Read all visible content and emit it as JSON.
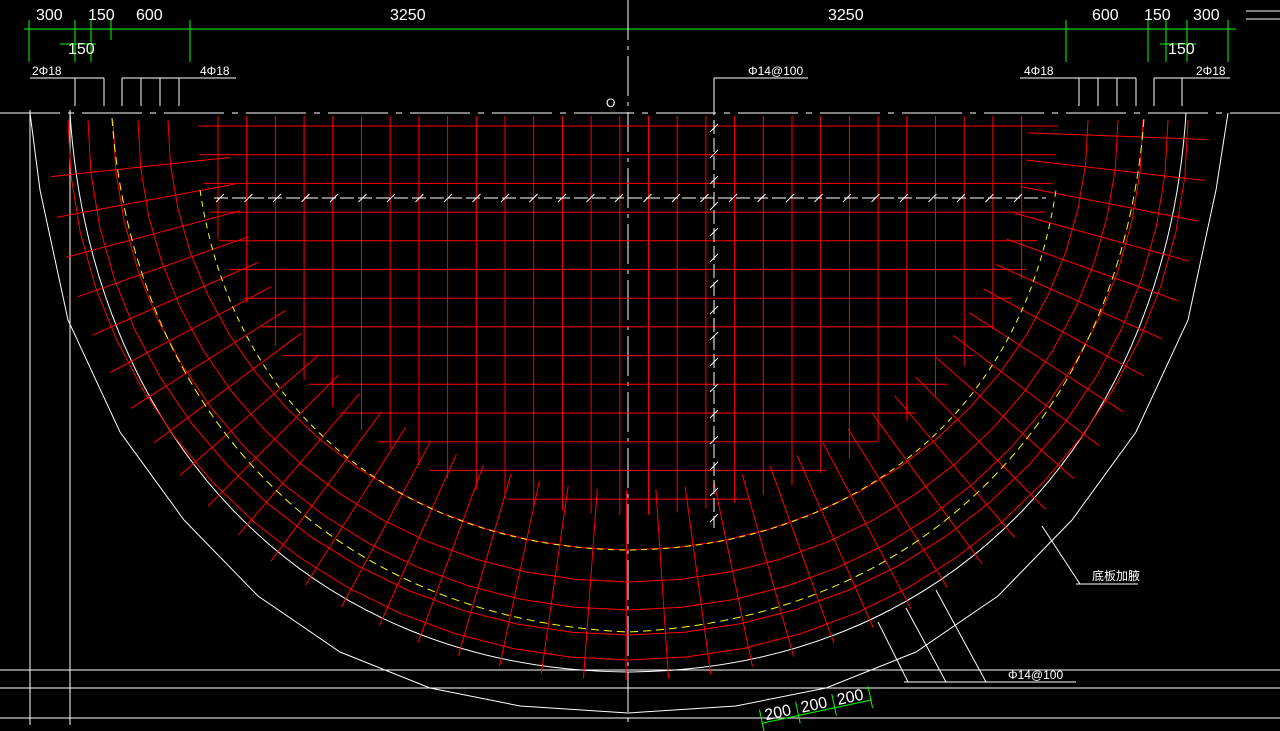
{
  "drawing": {
    "background": "#000000",
    "colors": {
      "dimension": "#00ff00",
      "rebar": "#ff0000",
      "outline": "#ffffff",
      "hidden_line": "#ffff00"
    },
    "dimensions_top": [
      "300",
      "150",
      "600",
      "3250",
      "3250",
      "600",
      "150",
      "300"
    ],
    "dimension_sub_left": "150",
    "dimension_sub_right": "150",
    "labels": {
      "left_corner_bars": "2Φ18",
      "left_bars": "4Φ18",
      "center_rebar": "Φ14@100",
      "right_bars": "4Φ18",
      "right_corner_bars": "2Φ18",
      "origin_mark": "O",
      "floor_haunch": "底板加腋",
      "ring_rebar": "Φ14@100"
    },
    "dimensions_bottom": [
      "200",
      "200",
      "200"
    ]
  }
}
